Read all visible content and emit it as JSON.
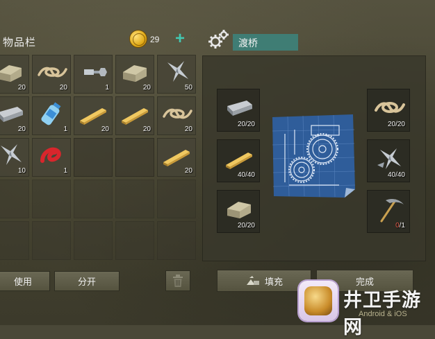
{
  "inventory": {
    "title": "物品栏",
    "coins": "29",
    "plus": "+",
    "slots": [
      {
        "item": "stone-icon",
        "qty": "20"
      },
      {
        "item": "rope-icon",
        "qty": "20"
      },
      {
        "item": "bolt-nut-icon",
        "qty": "1"
      },
      {
        "item": "stone-icon",
        "qty": "20"
      },
      {
        "item": "metal-scrap-icon",
        "qty": "50"
      },
      {
        "item": "iron-bar-icon",
        "qty": "20"
      },
      {
        "item": "water-bottle-icon",
        "qty": "1"
      },
      {
        "item": "wood-plank-icon",
        "qty": "20"
      },
      {
        "item": "wood-plank-icon",
        "qty": "20"
      },
      {
        "item": "rope-icon",
        "qty": "20"
      },
      {
        "item": "metal-scrap-icon",
        "qty": "10"
      },
      {
        "item": "red-tape-icon",
        "qty": "1"
      },
      {
        "item": "",
        "qty": ""
      },
      {
        "item": "",
        "qty": ""
      },
      {
        "item": "wood-plank-icon",
        "qty": "20"
      },
      {
        "item": "",
        "qty": ""
      },
      {
        "item": "",
        "qty": ""
      },
      {
        "item": "",
        "qty": ""
      },
      {
        "item": "",
        "qty": ""
      },
      {
        "item": "",
        "qty": ""
      },
      {
        "item": "",
        "qty": ""
      },
      {
        "item": "",
        "qty": ""
      },
      {
        "item": "",
        "qty": ""
      },
      {
        "item": "",
        "qty": ""
      },
      {
        "item": "",
        "qty": ""
      }
    ],
    "use_label": "使用",
    "split_label": "分开"
  },
  "craft": {
    "title": "渡桥",
    "materials_left": [
      {
        "item": "iron-bar-icon",
        "qty": "20/20"
      },
      {
        "item": "wood-plank-icon",
        "qty": "40/40"
      },
      {
        "item": "stone-icon",
        "qty": "20/20"
      }
    ],
    "materials_right": [
      {
        "item": "rope-icon",
        "qty": "20/20"
      },
      {
        "item": "metal-scrap-icon",
        "qty": "40/40"
      },
      {
        "item": "pickaxe-icon",
        "qty_have": "0",
        "qty_rest": "/1"
      }
    ],
    "fill_label": "填充",
    "done_label": "完成"
  },
  "watermark": {
    "text": "井卫手游网",
    "sub": "Android & iOS"
  },
  "colors": {
    "accent": "#43c7b0",
    "title_bg": "#3f7d74",
    "missing": "#e35a4a"
  }
}
